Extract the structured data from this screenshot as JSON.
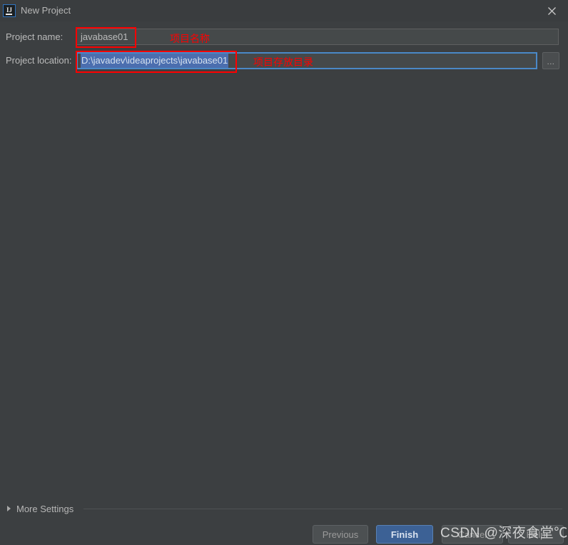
{
  "window": {
    "title": "New Project",
    "app_icon": "intellij-idea-icon",
    "close_icon": "close-icon"
  },
  "form": {
    "name_label": "Project name:",
    "name_value": "javabase01",
    "location_label": "Project location:",
    "location_value": "D:\\javadev\\ideaprojects\\javabase01",
    "browse_label": "...",
    "browse_icon": "ellipsis-icon"
  },
  "annotations": {
    "color": "#ff0000",
    "name_note": "项目名称",
    "location_note": "项目存放目录"
  },
  "more_settings": {
    "label": "More Settings",
    "expander_icon": "triangle-right-icon"
  },
  "buttons": {
    "previous": "Previous",
    "finish": "Finish",
    "cancel": "Cancel",
    "help": "Help"
  },
  "watermark": {
    "text": "CSDN @深夜食堂℃"
  },
  "colors": {
    "background": "#3c3f41",
    "titlebar": "#3a3d3f",
    "field_background": "#45494a",
    "focus_border": "#4a88c7",
    "selection": "#4b6eaf",
    "primary_button": "#3c6195",
    "annotation_red": "#ff0000"
  }
}
